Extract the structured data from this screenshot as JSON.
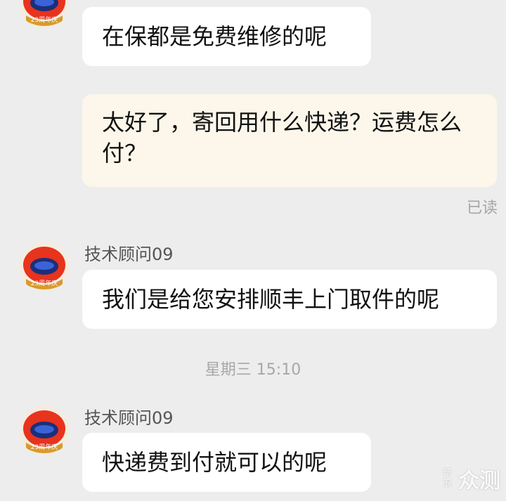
{
  "messages": [
    {
      "id": "m1",
      "side": "left",
      "text": "在保都是免费维修的呢",
      "avatar_badge": "23周年庆"
    },
    {
      "id": "m2",
      "side": "right",
      "text": "太好了，寄回用什么快递？运费怎么付？",
      "status": "已读"
    },
    {
      "id": "m3",
      "side": "left",
      "sender": "技术顾问09",
      "text": "我们是给您安排顺丰上门取件的呢",
      "avatar_badge": "23周年庆"
    },
    {
      "id": "m4",
      "side": "left",
      "sender": "技术顾问09",
      "text": "快递费到付就可以的呢",
      "avatar_badge": "23周年庆"
    }
  ],
  "timestamp": "星期三 15:10",
  "watermark": {
    "small": "新浪",
    "big": "众测"
  },
  "colors": {
    "background": "#ededed",
    "bubble_left": "#ffffff",
    "bubble_right": "#fcf7ea",
    "avatar_red": "#e8331d"
  }
}
